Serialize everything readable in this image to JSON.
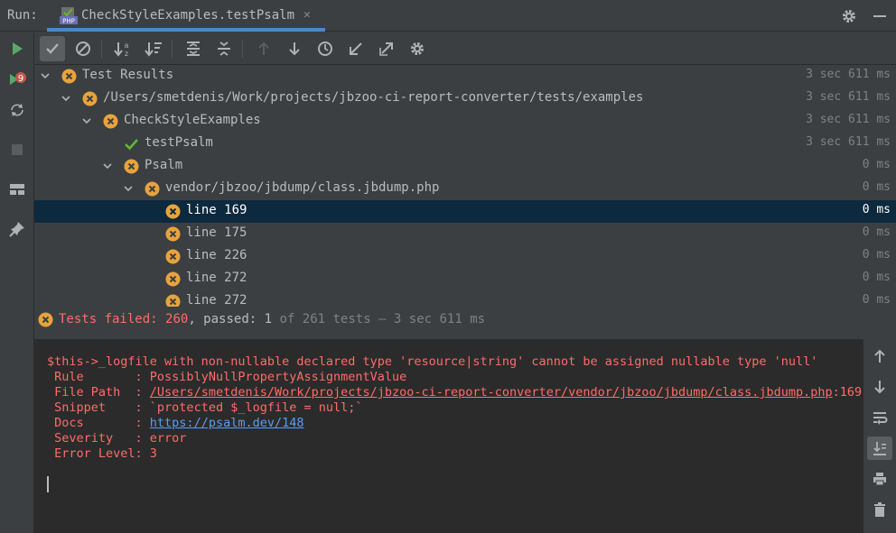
{
  "header": {
    "run_label": "Run:",
    "tab_title": "CheckStyleExamples.testPsalm",
    "tab_icon_text": "PHP"
  },
  "colors": {
    "fail": "#ff6b68",
    "pass": "#5fb832",
    "warning_icon": "#e8a33d",
    "selection": "#0d293e",
    "link": "#589df6",
    "tab_underline": "#4a88c7"
  },
  "tree": {
    "rows": [
      {
        "label": "Test Results",
        "duration": "3 sec 611 ms",
        "status": "fail",
        "expanded": true
      },
      {
        "label": "/Users/smetdenis/Work/projects/jbzoo-ci-report-converter/tests/examples",
        "duration": "3 sec 611 ms",
        "status": "fail",
        "expanded": true
      },
      {
        "label": "CheckStyleExamples",
        "duration": "3 sec 611 ms",
        "status": "fail",
        "expanded": true
      },
      {
        "label": "testPsalm",
        "duration": "3 sec 611 ms",
        "status": "pass"
      },
      {
        "label": "Psalm",
        "duration": "0 ms",
        "status": "fail",
        "expanded": true
      },
      {
        "label": "vendor/jbzoo/jbdump/class.jbdump.php",
        "duration": "0 ms",
        "status": "fail",
        "expanded": true
      },
      {
        "label": "line 169",
        "duration": "0 ms",
        "status": "fail",
        "selected": true
      },
      {
        "label": "line 175",
        "duration": "0 ms",
        "status": "fail"
      },
      {
        "label": "line 226",
        "duration": "0 ms",
        "status": "fail"
      },
      {
        "label": "line 272",
        "duration": "0 ms",
        "status": "fail"
      },
      {
        "label": "line 272",
        "duration": "0 ms",
        "status": "fail"
      }
    ]
  },
  "status": {
    "failed_label": "Tests failed: ",
    "failed_count": "260",
    "passed_label": ", passed: ",
    "passed_count": "1",
    "summary": " of 261 tests – 3 sec 611 ms"
  },
  "console": {
    "message": "$this->_logfile with non-nullable declared type 'resource|string' cannot be assigned nullable type 'null'",
    "rule_key": " Rule       : ",
    "rule_val": "PossiblyNullPropertyAssignmentValue",
    "file_key": " File Path  : ",
    "file_val": "/Users/smetdenis/Work/projects/jbzoo-ci-report-converter/vendor/jbzoo/jbdump/class.jbdump.php",
    "file_line": ":169",
    "snippet_key": " Snippet    : ",
    "snippet_val": "`protected $_logfile = null;`",
    "docs_key": " Docs       : ",
    "docs_val": "https://psalm.dev/148",
    "severity_key": " Severity   : ",
    "severity_val": "error",
    "level_key": " Error Level: ",
    "level_val": "3"
  }
}
